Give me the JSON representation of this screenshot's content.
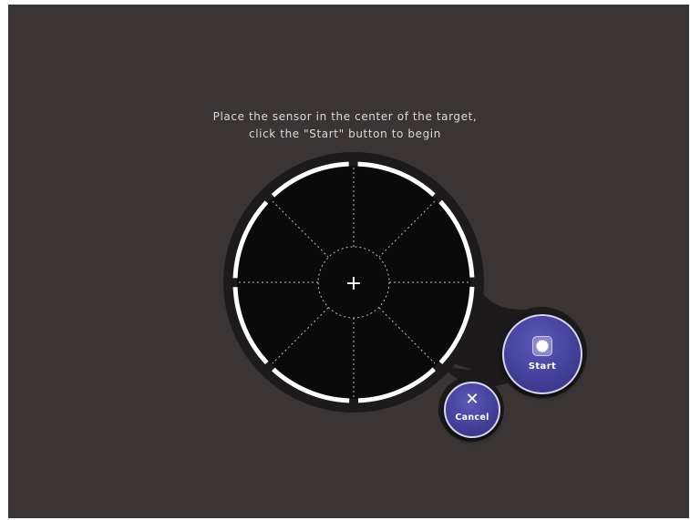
{
  "instructions": {
    "line1": "Place the sensor in the center of the target,",
    "line2": "click the \"Start\" button to begin"
  },
  "target": {
    "center_marker": "+"
  },
  "buttons": {
    "start": {
      "label": "Start",
      "icon": "gear-icon",
      "color": "#45409a"
    },
    "cancel": {
      "label": "Cancel",
      "icon": "close-icon",
      "glyph": "✕",
      "color": "#45409a"
    }
  },
  "colors": {
    "background": "#3a3434",
    "target_fill": "#0a0a0a",
    "ring": "#ffffff"
  }
}
